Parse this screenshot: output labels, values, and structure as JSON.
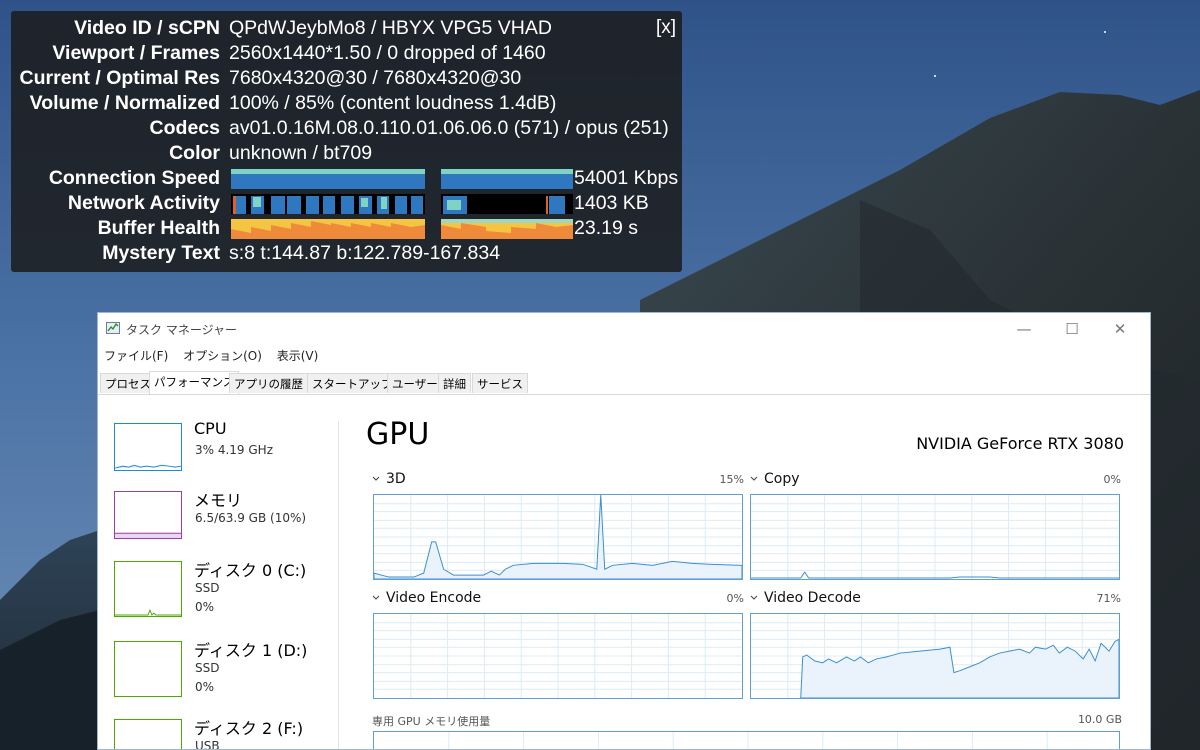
{
  "stats": {
    "close_label": "[x]",
    "rows": [
      {
        "label": "Video ID / sCPN",
        "value": "QPdWJeybMo8 / HBYX VPG5 VHAD"
      },
      {
        "label": "Viewport / Frames",
        "value": "2560x1440*1.50 / 0 dropped of 1460"
      },
      {
        "label": "Current / Optimal Res",
        "value": "7680x4320@30 / 7680x4320@30"
      },
      {
        "label": "Volume / Normalized",
        "value": "100% / 85% (content loudness 1.4dB)"
      },
      {
        "label": "Codecs",
        "value": "av01.0.16M.08.0.110.01.06.06.0 (571) / opus (251)"
      },
      {
        "label": "Color",
        "value": "unknown / bt709"
      },
      {
        "label": "Connection Speed",
        "value": "54001 Kbps"
      },
      {
        "label": "Network Activity",
        "value": "1403 KB"
      },
      {
        "label": "Buffer Health",
        "value": "23.19 s"
      },
      {
        "label": "Mystery Text",
        "value": "s:8 t:144.87 b:122.789-167.834"
      }
    ]
  },
  "taskmanager": {
    "title": "タスク マネージャー",
    "window_buttons": {
      "minimize": "—",
      "maximize": "☐",
      "close": "✕"
    },
    "menu": [
      "ファイル(F)",
      "オプション(O)",
      "表示(V)"
    ],
    "tabs": [
      "プロセス",
      "パフォーマンス",
      "アプリの履歴",
      "スタートアップ",
      "ユーザー",
      "詳細",
      "サービス"
    ],
    "active_tab": "パフォーマンス",
    "sidebar": [
      {
        "name": "CPU",
        "sub1": "3%  4.19 GHz",
        "sub2": "",
        "color": "#1c8bd6"
      },
      {
        "name": "メモリ",
        "sub1": "6.5/63.9 GB (10%)",
        "sub2": "",
        "color": "#9b3ea8"
      },
      {
        "name": "ディスク 0 (C:)",
        "sub1": "SSD",
        "sub2": "0%",
        "color": "#4da800"
      },
      {
        "name": "ディスク 1 (D:)",
        "sub1": "SSD",
        "sub2": "0%",
        "color": "#4da800"
      },
      {
        "name": "ディスク 2 (F:)",
        "sub1": "USB",
        "sub2": "",
        "color": "#4da800"
      }
    ],
    "gpu": {
      "title": "GPU",
      "model": "NVIDIA GeForce RTX 3080",
      "engines": [
        {
          "name": "3D",
          "percent": "15%"
        },
        {
          "name": "Copy",
          "percent": "0%"
        },
        {
          "name": "Video Encode",
          "percent": "0%"
        },
        {
          "name": "Video Decode",
          "percent": "71%"
        }
      ],
      "memory_label": "専用 GPU メモリ使用量",
      "memory_value": "10.0 GB"
    }
  }
}
